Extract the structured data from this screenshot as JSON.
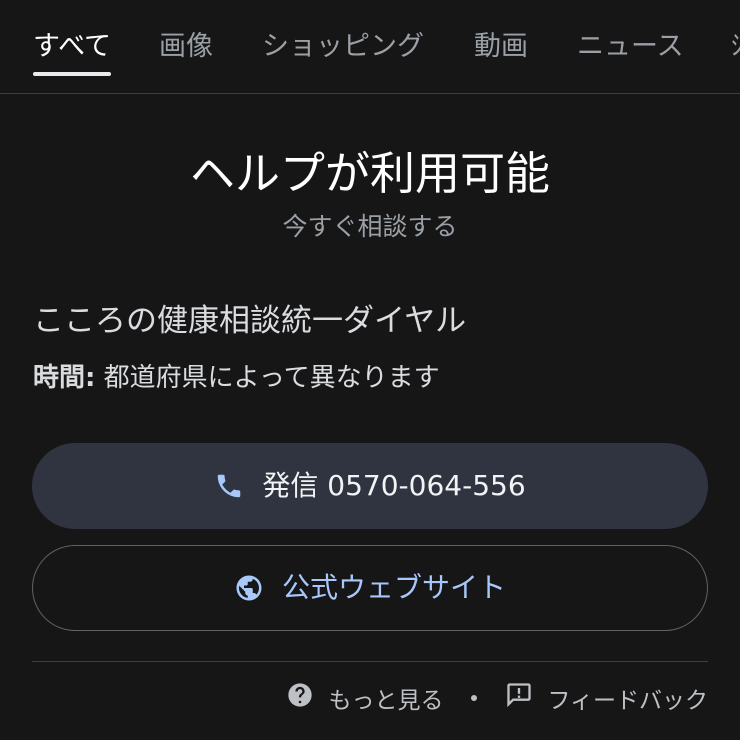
{
  "tabs": [
    {
      "label": "すべて",
      "active": true
    },
    {
      "label": "画像"
    },
    {
      "label": "ショッピング"
    },
    {
      "label": "動画"
    },
    {
      "label": "ニュース"
    },
    {
      "label": "ｼ"
    }
  ],
  "help": {
    "title": "ヘルプが利用可能",
    "subtitle": "今すぐ相談する"
  },
  "org": {
    "name": "こころの健康相談統一ダイヤル",
    "hours_label": "時間:",
    "hours_value": "都道府県によって異なります"
  },
  "buttons": {
    "call_prefix": "発信",
    "call_number": "0570-064-556",
    "call_icon": "phone-icon",
    "website_label": "公式ウェブサイト",
    "website_icon": "globe-icon"
  },
  "footer": {
    "more_label": "もっと見る",
    "more_icon": "help-circle-icon",
    "feedback_label": "フィードバック",
    "feedback_icon": "feedback-icon"
  },
  "colors": {
    "background": "#161616",
    "call_button_bg": "#303440",
    "link_blue": "#a8c7fa",
    "muted_text": "#9aa0a6"
  }
}
